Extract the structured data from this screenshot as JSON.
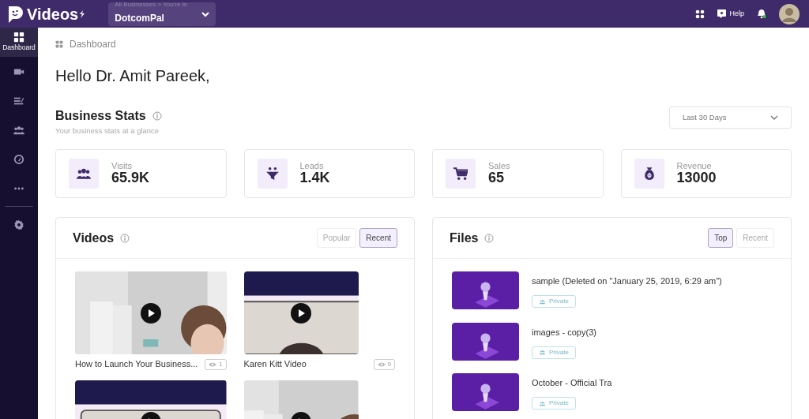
{
  "app": {
    "title": "Videos"
  },
  "business_selector": {
    "label": "All Businesses > You're in",
    "value": "DotcomPal"
  },
  "header_actions": {
    "help": "Help",
    "notifications_unread": true
  },
  "sidebar": {
    "items": [
      {
        "kind": "dashboard",
        "label": "Dashboard",
        "selected": true
      },
      {
        "kind": "video",
        "selected": false
      },
      {
        "kind": "list",
        "selected": false
      },
      {
        "kind": "people",
        "selected": false
      },
      {
        "kind": "gauge",
        "selected": false
      },
      {
        "kind": "more",
        "selected": false
      },
      {
        "kind": "settings",
        "selected": false
      }
    ]
  },
  "breadcrumb": "Dashboard",
  "greeting": "Hello Dr. Amit Pareek,",
  "business_stats": {
    "title": "Business Stats",
    "subtitle": "Your business stats at a glance",
    "period": "Last 30 Days",
    "stats": [
      {
        "kind": "visits",
        "label": "Visits",
        "value": "65.9K"
      },
      {
        "kind": "leads",
        "label": "Leads",
        "value": "1.4K"
      },
      {
        "kind": "sales",
        "label": "Sales",
        "value": "65"
      },
      {
        "kind": "revenue",
        "label": "Revenue",
        "value": "13000"
      }
    ]
  },
  "videos": {
    "title": "Videos",
    "tabs": [
      {
        "label": "Popular",
        "selected": false
      },
      {
        "label": "Recent",
        "selected": true
      }
    ],
    "items": [
      {
        "kind": "room",
        "title": "How to Launch Your Business...",
        "views": "1"
      },
      {
        "kind": "banner",
        "title": "Karen Kitt Video",
        "views": "0"
      },
      {
        "kind": "banner"
      },
      {
        "kind": "room"
      }
    ]
  },
  "files": {
    "title": "Files",
    "tabs": [
      {
        "label": "Top",
        "selected": true
      },
      {
        "label": "Recent",
        "selected": false
      }
    ],
    "items": [
      {
        "name": "sample (Deleted on \"January 25, 2019, 6:29 am\")",
        "visibility": "Private"
      },
      {
        "name": "images - copy(3)",
        "visibility": "Private"
      },
      {
        "name": "October - Official Tra",
        "visibility": "Private"
      }
    ]
  }
}
